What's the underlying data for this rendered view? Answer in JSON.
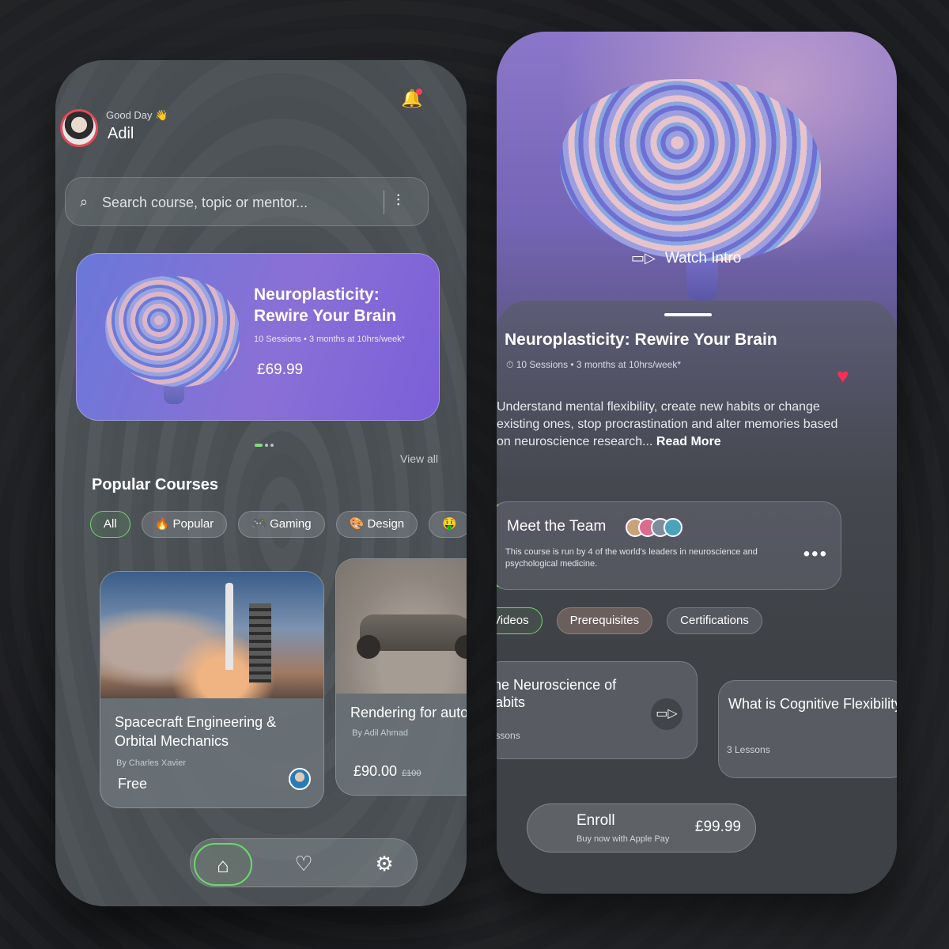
{
  "home": {
    "greeting": "Good Day 👋",
    "user_name": "Adil",
    "search": {
      "placeholder": "Search course, topic or mentor..."
    },
    "featured": {
      "title": "Neuroplasticity: Rewire Your Brain",
      "meta": "10 Sessions • 3 months at 10hrs/week*",
      "price": "£69.99"
    },
    "section_title": "Popular Courses",
    "view_all": "View all",
    "chips": [
      {
        "label": "All"
      },
      {
        "label": "🔥 Popular"
      },
      {
        "label": "🎮 Gaming"
      },
      {
        "label": "🎨 Design"
      },
      {
        "label": "🤑"
      }
    ],
    "courses": [
      {
        "title": "Spacecraft Engineering & Orbital Mechanics",
        "author": "By Charles Xavier",
        "price": "Free"
      },
      {
        "title": "Rendering for auto",
        "author": "By Adil Ahmad",
        "price": "£90.00",
        "old_price": "£100"
      }
    ],
    "nav": {
      "home_icon": "⌂",
      "favorite_icon": "♡",
      "settings_icon": "⚙"
    },
    "accent": "#6bd96a"
  },
  "detail": {
    "watch_intro": "Watch Intro",
    "title": "Neuroplasticity: Rewire Your Brain",
    "meta": "⏱ 10 Sessions • 3 months at 10hrs/week*",
    "description": "Understand mental flexibility, create new habits or change existing ones, stop procrastination and alter memories based on neuroscience research...",
    "read_more": "Read More",
    "team": {
      "title": "Meet the Team",
      "description": "This course is run by 4 of the world's leaders in neuroscience and psychological medicine."
    },
    "tabs": [
      {
        "label": "Videos"
      },
      {
        "label": "Prerequisites"
      },
      {
        "label": "Certifications"
      }
    ],
    "lessons": [
      {
        "title": "The Neuroscience of Habits",
        "count": "Lessons"
      },
      {
        "title": "What is Cognitive Flexibility",
        "count": "3 Lessons"
      }
    ],
    "enroll": {
      "label": "Enroll",
      "subtitle": "Buy now with Apple Pay",
      "price": "£99.99"
    },
    "heart_color": "#ff2d55"
  }
}
